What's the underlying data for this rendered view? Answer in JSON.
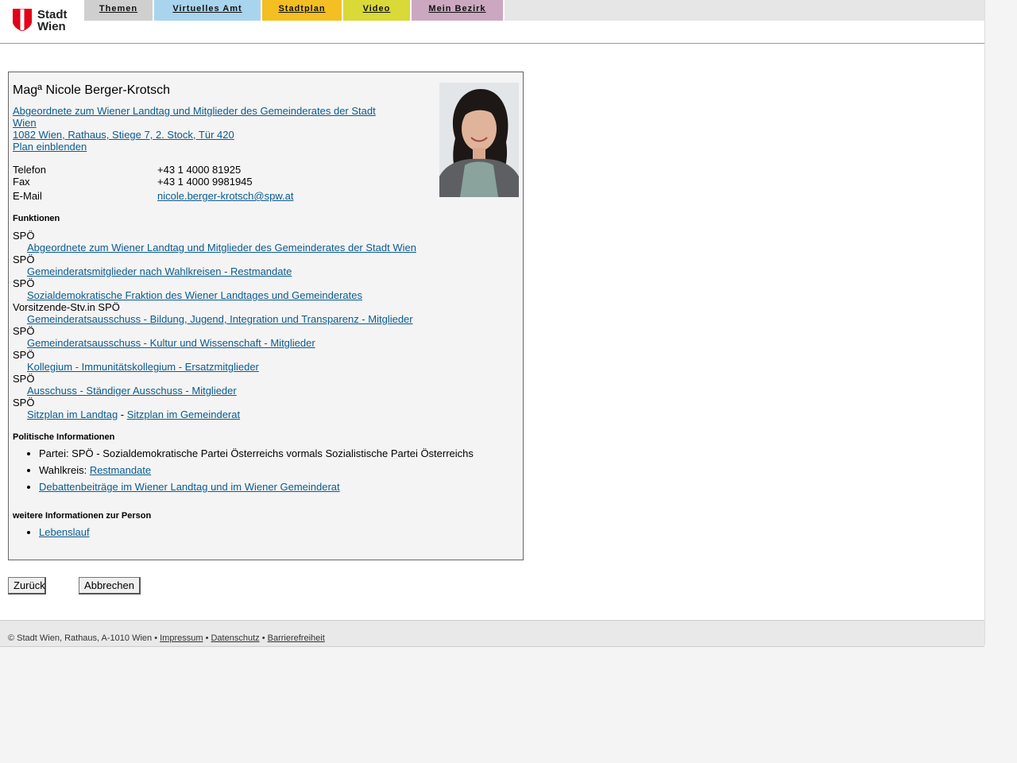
{
  "logo": {
    "line1": "Stadt",
    "line2": "Wien",
    "colors": {
      "shield": "#e2001a"
    }
  },
  "nav": {
    "tabs": [
      {
        "label": "Themen",
        "color": "#cfcfcf"
      },
      {
        "label": "Virtuelles Amt",
        "color": "#a9d4ee"
      },
      {
        "label": "Stadtplan",
        "color": "#f3bf22"
      },
      {
        "label": "Video",
        "color": "#d9d937"
      },
      {
        "label": "Mein Bezirk",
        "color": "#cba8c0"
      }
    ]
  },
  "person": {
    "name": "Magª Nicole Berger-Krotsch",
    "role_line1": "Abgeordnete zum Wiener Landtag und Mitglieder des Gemeinderates der Stadt",
    "role_line2": "Wien ",
    "address": "1082 Wien, Rathaus, Stiege 7, 2. Stock, Tür 420",
    "plan_link": "Plan einblenden",
    "contact": {
      "phone_label": "Telefon",
      "phone": "+43 1 4000 81925",
      "fax_label": "Fax",
      "fax": "+43 1 4000 9981945",
      "email_label": "E-Mail",
      "email": "nicole.berger-krotsch@spw.at"
    }
  },
  "functions": {
    "heading": "Funktionen",
    "items": [
      {
        "org": "SPÖ",
        "role": "Abgeordnete zum Wiener Landtag und Mitglieder des Gemeinderates der Stadt Wien"
      },
      {
        "org": "SPÖ",
        "role": "Gemeinderatsmitglieder nach Wahlkreisen - Restmandate"
      },
      {
        "org": "SPÖ",
        "role": "Sozialdemokratische Fraktion des Wiener Landtages und Gemeinderates"
      },
      {
        "org": "Vorsitzende-Stv.in SPÖ",
        "role": "Gemeinderatsausschuss - Bildung, Jugend, Integration und Transparenz - Mitglieder"
      },
      {
        "org": "SPÖ",
        "role": "Gemeinderatsausschuss - Kultur und Wissenschaft - Mitglieder"
      },
      {
        "org": "SPÖ",
        "role": "Kollegium - Immunitätskollegium - Ersatzmitglieder"
      },
      {
        "org": "SPÖ",
        "role": "Ausschuss - Ständiger Ausschuss - Mitglieder"
      }
    ],
    "last_org": "SPÖ",
    "seat_landtag": "Sitzplan im Landtag",
    "seat_sep": " - ",
    "seat_gemeinderat": "Sitzplan im Gemeinderat"
  },
  "political": {
    "heading": "Politische Informationen",
    "party": "Partei: SPÖ - Sozialdemokratische Partei Österreichs vormals Sozialistische Partei Österreichs",
    "district_label": "Wahlkreis: ",
    "district_link": "Restmandate",
    "debates_link": "Debattenbeiträge im Wiener Landtag und im Wiener Gemeinderat"
  },
  "further": {
    "heading": "weitere Informationen zur Person",
    "cv_link": "Lebenslauf"
  },
  "buttons": {
    "back": "Zurück",
    "cancel": "Abbrechen"
  },
  "footer": {
    "copyright": "© Stadt Wien, Rathaus, A-1010 Wien • ",
    "impressum": "Impressum",
    "sep1": " • ",
    "datenschutz": "Datenschutz",
    "sep2": " • ",
    "barrierefreiheit": "Barrierefreiheit"
  }
}
